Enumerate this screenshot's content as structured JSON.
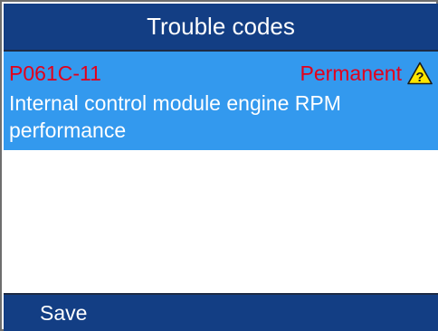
{
  "header": {
    "title": "Trouble codes"
  },
  "dtc_list": [
    {
      "code": "P061C-11",
      "status": "Permanent",
      "description": "Internal control module engine RPM performance",
      "icon": "warning-question-icon"
    }
  ],
  "footer": {
    "save_label": "Save"
  },
  "colors": {
    "header_bg": "#133e84",
    "selected_row_bg": "#3399ee",
    "code_text": "#e3001b",
    "warning_icon_fill": "#ffe600"
  }
}
